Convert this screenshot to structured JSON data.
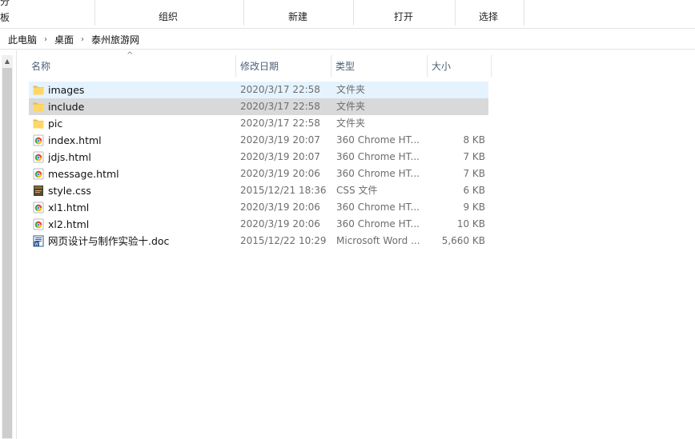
{
  "ribbon": {
    "truncated_top": "分",
    "truncated_bottom": "板",
    "groups": [
      "组织",
      "新建",
      "打开",
      "选择"
    ]
  },
  "address": {
    "crumbs": [
      "此电脑",
      "桌面",
      "泰州旅游网"
    ],
    "separator": "›"
  },
  "columns": {
    "name": "名称",
    "date": "修改日期",
    "type": "类型",
    "size": "大小",
    "sort_indicator": "^"
  },
  "files": [
    {
      "name": "images",
      "date": "2020/3/17 22:58",
      "type": "文件夹",
      "size": "",
      "icon": "folder-icon",
      "state": "hover"
    },
    {
      "name": "include",
      "date": "2020/3/17 22:58",
      "type": "文件夹",
      "size": "",
      "icon": "folder-icon",
      "state": "selected"
    },
    {
      "name": "pic",
      "date": "2020/3/17 22:58",
      "type": "文件夹",
      "size": "",
      "icon": "folder-icon",
      "state": ""
    },
    {
      "name": "index.html",
      "date": "2020/3/19 20:07",
      "type": "360 Chrome HT...",
      "size": "8 KB",
      "icon": "chrome-html-icon",
      "state": ""
    },
    {
      "name": "jdjs.html",
      "date": "2020/3/19 20:07",
      "type": "360 Chrome HT...",
      "size": "7 KB",
      "icon": "chrome-html-icon",
      "state": ""
    },
    {
      "name": "message.html",
      "date": "2020/3/19 20:06",
      "type": "360 Chrome HT...",
      "size": "7 KB",
      "icon": "chrome-html-icon",
      "state": ""
    },
    {
      "name": "style.css",
      "date": "2015/12/21 18:36",
      "type": "CSS 文件",
      "size": "6 KB",
      "icon": "css-file-icon",
      "state": ""
    },
    {
      "name": "xl1.html",
      "date": "2020/3/19 20:06",
      "type": "360 Chrome HT...",
      "size": "9 KB",
      "icon": "chrome-html-icon",
      "state": ""
    },
    {
      "name": "xl2.html",
      "date": "2020/3/19 20:06",
      "type": "360 Chrome HT...",
      "size": "10 KB",
      "icon": "chrome-html-icon",
      "state": ""
    },
    {
      "name": "网页设计与制作实验十.doc",
      "date": "2015/12/22 10:29",
      "type": "Microsoft Word ...",
      "size": "5,660 KB",
      "icon": "word-doc-icon",
      "state": ""
    }
  ],
  "colors": {
    "hover_row": "#e5f3ff",
    "selected_row": "#d9d9d9",
    "folder": "#ffd766",
    "header_text": "#4c607a"
  }
}
